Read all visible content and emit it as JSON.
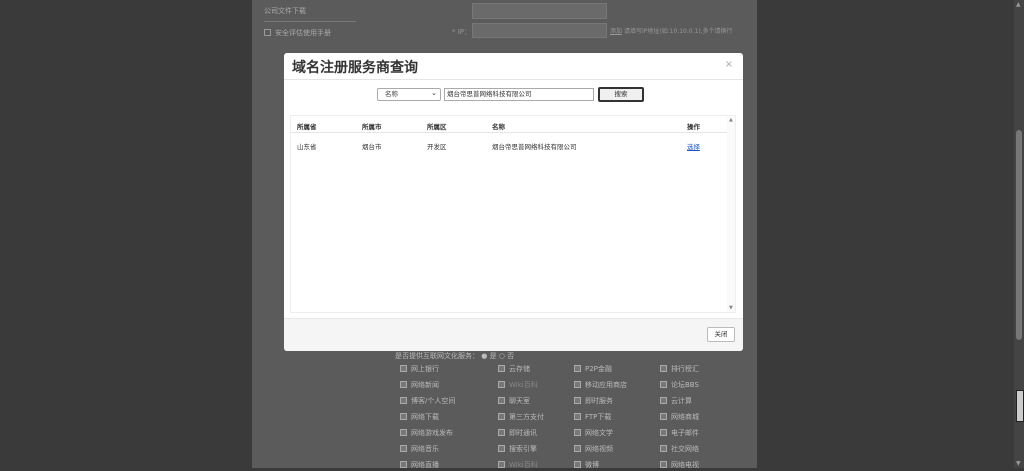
{
  "background": {
    "side_title": "公司文件下载",
    "side_item": "安全评估使用手册",
    "ip_label": "* IP：",
    "ip_hint_link": "添加",
    "ip_hint_text": "请填写IP地址(如:10.10.0.1),多个请换行",
    "question": "是否提供互联网文化服务：",
    "question_yes": "是",
    "question_no": "否",
    "grid": [
      "网上银行",
      "云存储",
      "P2P金融",
      "排行榜汇",
      "网络新闻",
      "Wiki百科",
      "移动应用商店",
      "论坛BBS",
      "博客/个人空间",
      "聊天室",
      "即时服务",
      "云计算",
      "网络下载",
      "第三方支付",
      "FTP下载",
      "网络商城",
      "网络游戏发布",
      "即时通讯",
      "网络文学",
      "电子邮件",
      "网络音乐",
      "搜索引擎",
      "网络视频",
      "社交网络",
      "网络直播",
      "Wiki百科",
      "微博",
      "网络电视"
    ],
    "grid_dim": [
      false,
      false,
      false,
      false,
      false,
      true,
      false,
      false,
      false,
      false,
      false,
      false,
      false,
      false,
      false,
      false,
      false,
      false,
      false,
      false,
      false,
      false,
      false,
      false,
      false,
      true,
      false,
      false
    ]
  },
  "modal": {
    "title": "域名注册服务商查询",
    "close_icon": "×",
    "search": {
      "field_selected": "名称",
      "field_chevron": "⌄",
      "input_value": "烟台帝思普网络科技有限公司",
      "button_label": "搜索"
    },
    "table": {
      "headers": [
        "所属省",
        "所属市",
        "所属区",
        "名称",
        "操作"
      ],
      "rows": [
        {
          "province": "山东省",
          "city": "烟台市",
          "district": "开发区",
          "name": "烟台帝思普网络科技有限公司",
          "action": "选择"
        }
      ]
    },
    "footer": {
      "close_label": "关闭"
    }
  },
  "colors": {
    "overlay": "#3a3a3a",
    "link": "#1a56c4"
  }
}
